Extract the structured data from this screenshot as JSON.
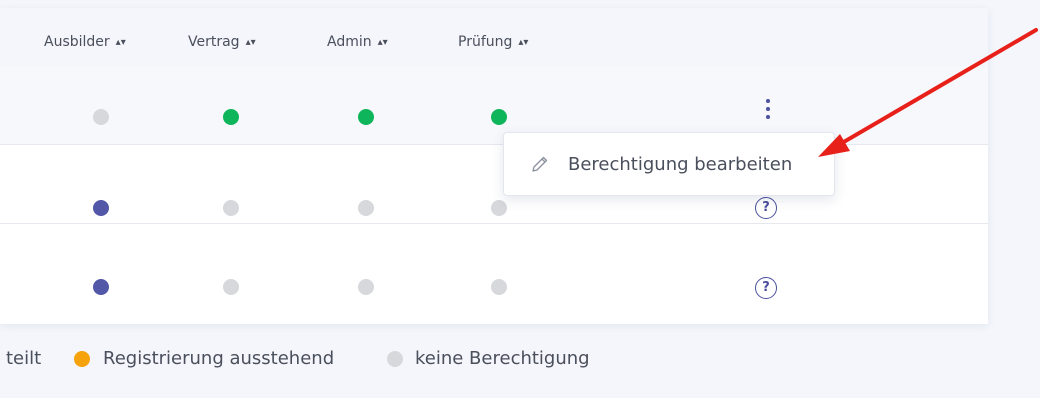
{
  "table": {
    "columns": [
      {
        "label": "Ausbilder",
        "sort_icon": "sort-icon"
      },
      {
        "label": "Vertrag",
        "sort_icon": "sort-icon"
      },
      {
        "label": "Admin",
        "sort_icon": "sort-icon"
      },
      {
        "label": "Prüfung",
        "sort_icon": "sort-icon"
      }
    ],
    "rows": [
      {
        "status": [
          "gray",
          "green",
          "green",
          "green"
        ],
        "action": "kebab-menu"
      },
      {
        "status": [
          "blue",
          "gray",
          "gray",
          "gray"
        ],
        "action": "?"
      },
      {
        "status": [
          "blue",
          "gray",
          "gray",
          "gray"
        ],
        "action": "?"
      }
    ]
  },
  "context_menu": {
    "item_label": "Berechtigung bearbeiten",
    "item_icon": "pencil-icon"
  },
  "legend": [
    {
      "label": "teilt",
      "color": null
    },
    {
      "label": "Registrierung ausstehend",
      "color": "#f5a20b"
    },
    {
      "label": "keine Berechtigung",
      "color": "#d7d8dc"
    }
  ],
  "colors": {
    "green": "#0fb55a",
    "blue": "#5257a8",
    "gray": "#d7d8dc",
    "orange": "#f5a20b",
    "annotation_arrow": "#e8201a"
  }
}
